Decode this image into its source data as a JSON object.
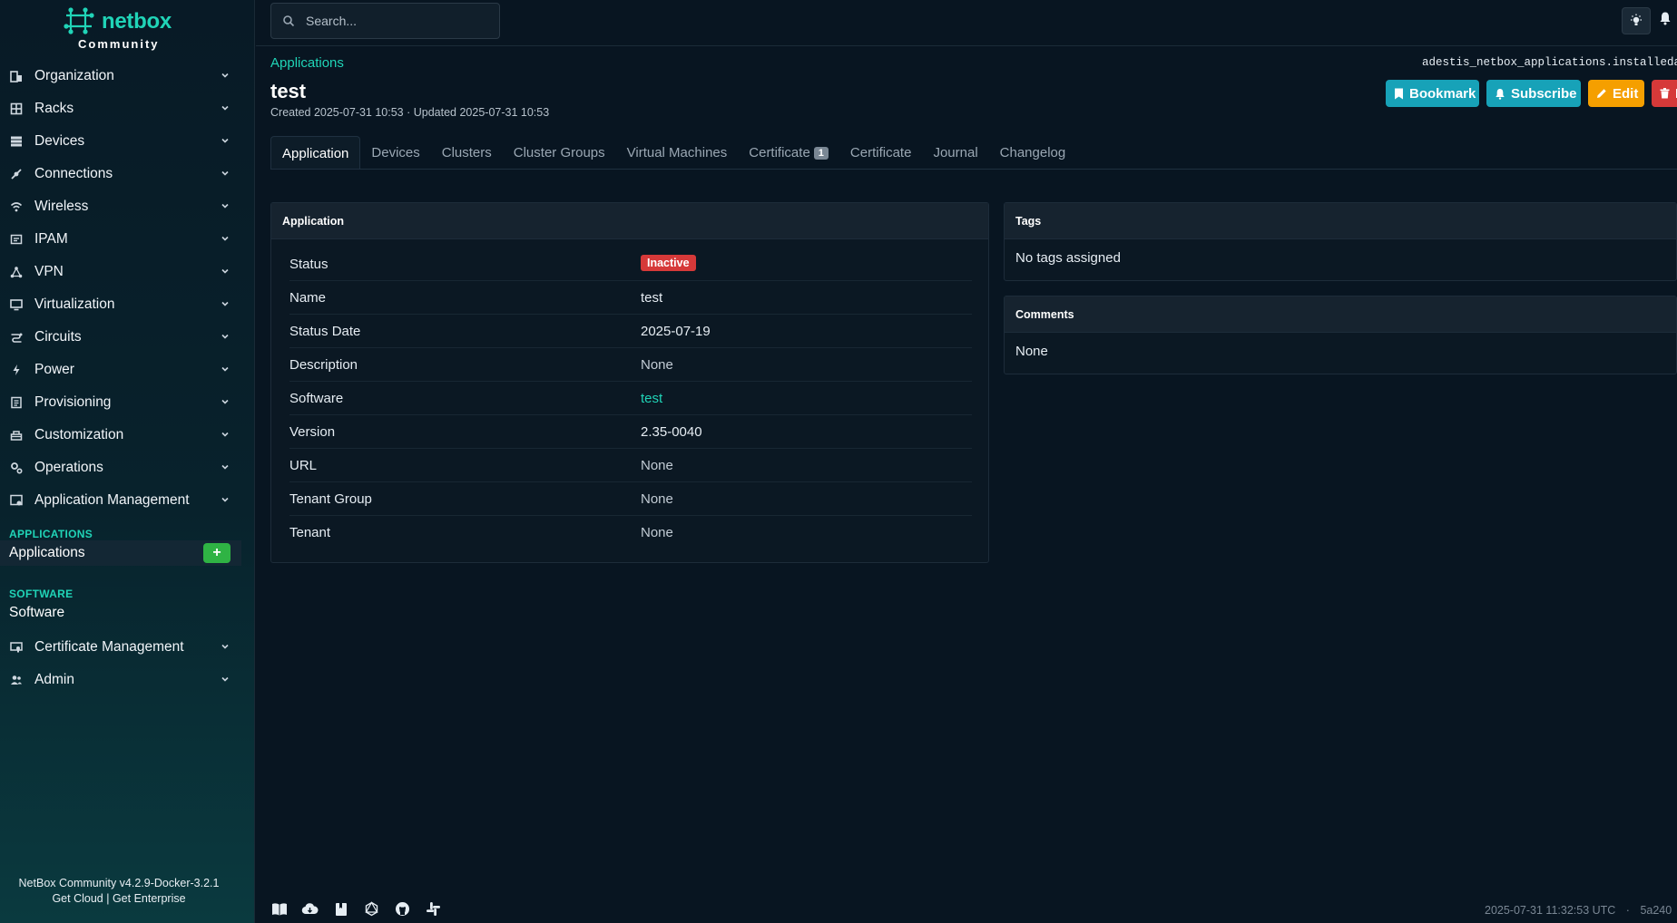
{
  "brand": {
    "name": "netbox",
    "edition": "Community"
  },
  "nav": {
    "items": [
      {
        "label": "Organization",
        "icon": "organization-icon"
      },
      {
        "label": "Racks",
        "icon": "racks-icon"
      },
      {
        "label": "Devices",
        "icon": "devices-icon"
      },
      {
        "label": "Connections",
        "icon": "connections-icon"
      },
      {
        "label": "Wireless",
        "icon": "wireless-icon"
      },
      {
        "label": "IPAM",
        "icon": "ipam-icon"
      },
      {
        "label": "VPN",
        "icon": "vpn-icon"
      },
      {
        "label": "Virtualization",
        "icon": "virtualization-icon"
      },
      {
        "label": "Circuits",
        "icon": "circuits-icon"
      },
      {
        "label": "Power",
        "icon": "power-icon"
      },
      {
        "label": "Provisioning",
        "icon": "provisioning-icon"
      },
      {
        "label": "Customization",
        "icon": "customization-icon"
      },
      {
        "label": "Operations",
        "icon": "operations-icon"
      },
      {
        "label": "Application Management",
        "icon": "application-management-icon"
      }
    ],
    "sections": {
      "applications_heading": "APPLICATIONS",
      "applications_item": "Applications",
      "software_heading": "SOFTWARE",
      "software_item": "Software"
    },
    "bottom_items": [
      {
        "label": "Certificate Management",
        "icon": "certificate-management-icon"
      },
      {
        "label": "Admin",
        "icon": "admin-icon"
      }
    ],
    "add_label": "+"
  },
  "sidebar_footer": {
    "version": "NetBox Community v4.2.9-Docker-3.2.1",
    "cloud": "Get Cloud",
    "separator": "|",
    "enterprise": "Get Enterprise"
  },
  "search": {
    "placeholder": "Search..."
  },
  "header": {
    "breadcrumb": "Applications",
    "object_path": "adestis_netbox_applications.installedapplication",
    "title": "test",
    "meta": "Created 2025-07-31 10:53 · Updated 2025-07-31 10:53"
  },
  "actions": {
    "bookmark": "Bookmark",
    "subscribe": "Subscribe",
    "edit": "Edit",
    "delete": "D"
  },
  "tabs": [
    {
      "label": "Application",
      "active": true
    },
    {
      "label": "Devices"
    },
    {
      "label": "Clusters"
    },
    {
      "label": "Cluster Groups"
    },
    {
      "label": "Virtual Machines"
    },
    {
      "label": "Certificate",
      "badge": "1"
    },
    {
      "label": "Certificate"
    },
    {
      "label": "Journal"
    },
    {
      "label": "Changelog"
    }
  ],
  "application_card": {
    "title": "Application",
    "status_label": "Status",
    "status_value": "Inactive",
    "rows": [
      {
        "key": "Name",
        "value": "test"
      },
      {
        "key": "Status Date",
        "value": "2025-07-19"
      },
      {
        "key": "Description",
        "value": "None"
      },
      {
        "key": "Software",
        "value": "test"
      },
      {
        "key": "Version",
        "value": "2.35-0040"
      },
      {
        "key": "URL",
        "value": "None"
      },
      {
        "key": "Tenant Group",
        "value": "None"
      },
      {
        "key": "Tenant",
        "value": "None"
      }
    ]
  },
  "tags_card": {
    "title": "Tags",
    "body": "No tags assigned"
  },
  "comments_card": {
    "title": "Comments",
    "body": "None"
  },
  "footer": {
    "timestamp": "2025-07-31 11:32:53 UTC",
    "dot": "·",
    "commit": "5a240"
  },
  "colors": {
    "accent": "#20d4b7",
    "danger": "#d63939",
    "info": "#17a2b8",
    "warning": "#f59f00",
    "success": "#2fb344"
  }
}
